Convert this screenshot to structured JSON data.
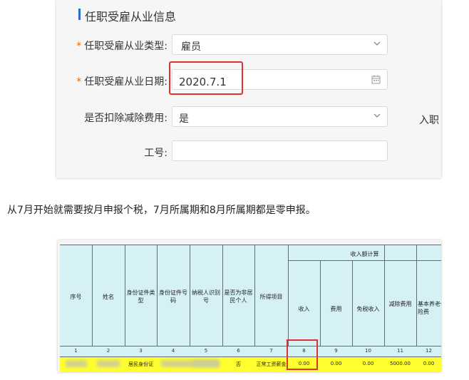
{
  "form": {
    "section_title": "任职受雇从业信息",
    "employment_type": {
      "label": "任职受雇从业类型:",
      "required_mark": "*",
      "value": "雇员"
    },
    "employment_date": {
      "label": "任职受雇从业日期:",
      "required_mark": "*",
      "value": "2020.7.1"
    },
    "deduction": {
      "label": "是否扣除减除费用:",
      "value": "是"
    },
    "employee_id": {
      "label": "工号:",
      "value": ""
    },
    "cut_label": "入职"
  },
  "sentence": "从7月开始就需要按月申报个税，7月所属期和8月所属期都是零申报。",
  "table": {
    "group_header": "收入额计算",
    "headers": [
      "序号",
      "姓名",
      "身份证件类型",
      "身份证件号码",
      "纳税人识别号",
      "是否为非居民个人",
      "所得项目",
      "收入",
      "费用",
      "免税收入",
      "减除费用",
      "基本养老保险费"
    ],
    "numbers": [
      "1",
      "2",
      "3",
      "4",
      "5",
      "6",
      "7",
      "8",
      "9",
      "10",
      "11",
      "12"
    ],
    "row": {
      "id_type": "居民身份证",
      "non_resident": "否",
      "income_item": "正常工资薪金",
      "income": "0.00",
      "expense": "0.00",
      "tax_free": "0.00",
      "deduction": "5000.00",
      "pension": "0.00"
    }
  },
  "colors": {
    "accent_bar": "#2f6ad0",
    "required": "#e26b00",
    "highlight": "#e03030",
    "row_yellow": "#ffff30",
    "header_bg": "#d6f1f5"
  }
}
